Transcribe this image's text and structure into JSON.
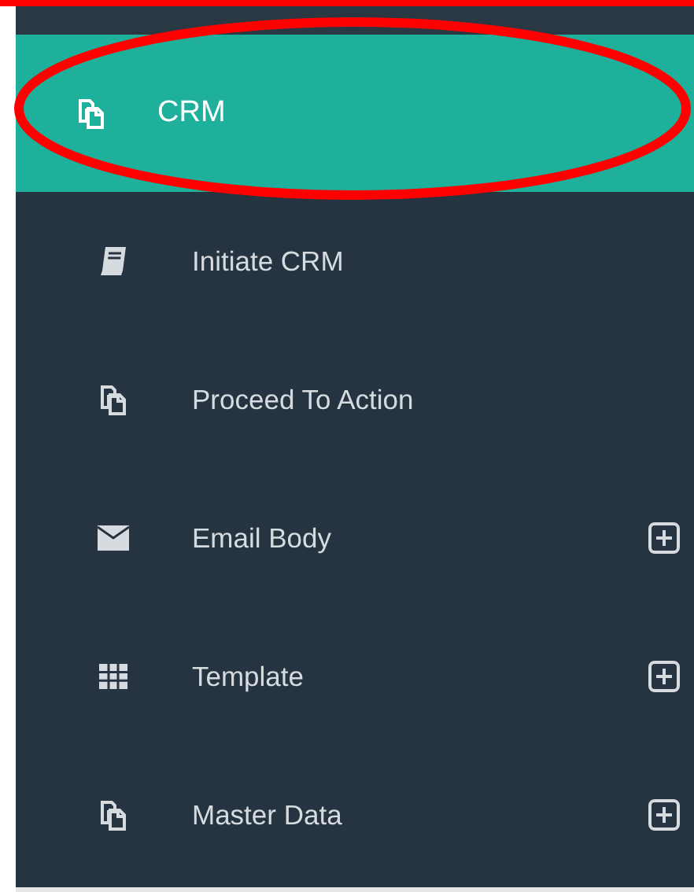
{
  "menu": {
    "label": "CRM",
    "kind": "copy",
    "selected": true,
    "children": [
      {
        "label": "Initiate CRM",
        "kind": "book",
        "expandable": false
      },
      {
        "label": "Proceed To Action",
        "kind": "copy",
        "expandable": false
      },
      {
        "label": "Email Body",
        "kind": "envelope",
        "expandable": true
      },
      {
        "label": "Template",
        "kind": "grid",
        "expandable": true
      },
      {
        "label": "Master Data",
        "kind": "copy",
        "expandable": true
      }
    ]
  }
}
